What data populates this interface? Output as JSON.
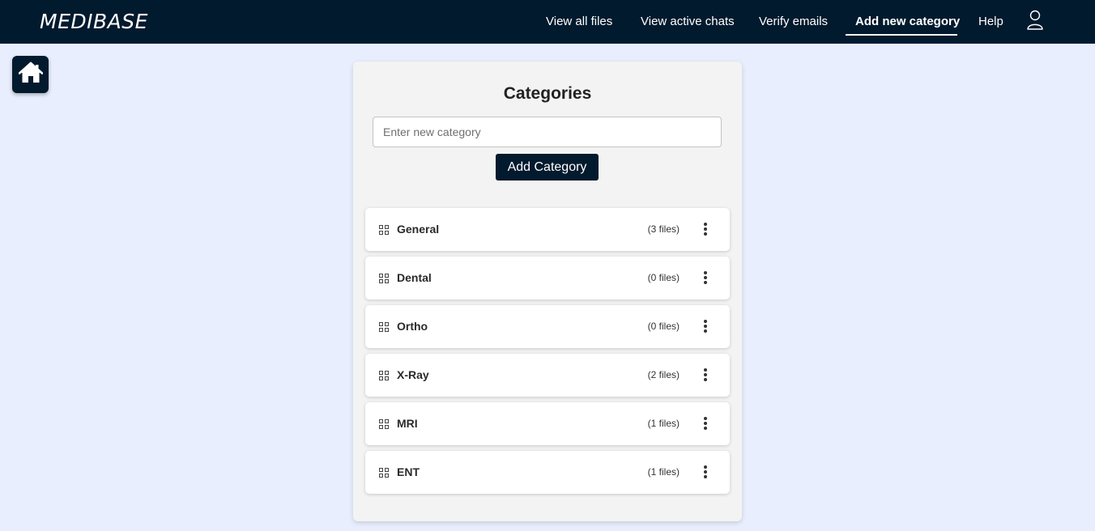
{
  "navbar": {
    "brand": "MEDIBASE",
    "links": [
      {
        "label": "View all files"
      },
      {
        "label": "View active chats"
      },
      {
        "label": "Verify emails"
      },
      {
        "label": "Add new category"
      },
      {
        "label": "Help"
      }
    ],
    "active_index": 3,
    "user_icon": "user-icon"
  },
  "home": {
    "icon": "home-icon"
  },
  "categories": {
    "title": "Categories",
    "input_placeholder": "Enter new category",
    "input_value": "",
    "add_label": "Add Category",
    "items": [
      {
        "name": "General",
        "count": "(3 files)"
      },
      {
        "name": "Dental",
        "count": "(0 files)"
      },
      {
        "name": "Ortho",
        "count": "(0 files)"
      },
      {
        "name": "X-Ray",
        "count": "(2 files)"
      },
      {
        "name": "MRI",
        "count": "(1 files)"
      },
      {
        "name": "ENT",
        "count": "(1 files)"
      }
    ],
    "item_icon": "category-grid-icon",
    "menu_icon": "more-vertical-icon"
  },
  "colors": {
    "navbar_bg": "#021a2e",
    "page_bg": "#e8eefd",
    "card_bg": "#f3f3f3",
    "button_bg": "#021a2e"
  }
}
